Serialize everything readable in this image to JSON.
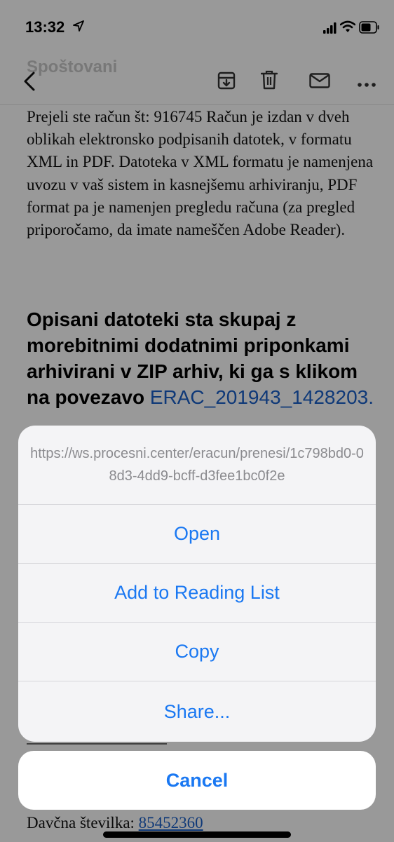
{
  "status_bar": {
    "time": "13:32"
  },
  "nav": {
    "subject": "Spoštovani"
  },
  "email": {
    "paragraph": "Prejeli ste račun št: 916745 Račun je izdan v dveh oblikah elektronsko podpisanih datotek, v formatu XML in PDF. Datoteka v XML formatu je namenjena uvozu v vaš sistem in kasnejšemu arhiviranju, PDF format pa je namenjen pregledu računa (za pregled priporočamo, da imate nameščen Adobe Reader).",
    "heading": "Opisani datoteki sta skupaj z morebitnimi dodatnimi priponkami arhivirani v ZIP arhiv, ki ga s klikom na povezavo",
    "link": "ERAC_201943_1428203.",
    "tax_label": "Davčna številka:",
    "tax_number": "85452360"
  },
  "action_sheet": {
    "url": "https://ws.procesni.center/eracun/prenesi/1c798bd0-08d3-4dd9-bcff-d3fee1bc0f2e",
    "items": [
      {
        "label": "Open"
      },
      {
        "label": "Add to Reading List"
      },
      {
        "label": "Copy"
      },
      {
        "label": "Share..."
      }
    ],
    "cancel": "Cancel"
  },
  "colors": {
    "accent": "#1a78f2",
    "link": "#1a5fc9",
    "overlay": "rgba(0,0,0,0.4)"
  },
  "icons": [
    "location-arrow-icon",
    "signal-icon",
    "wifi-icon",
    "battery-icon",
    "back-icon",
    "archive-icon",
    "trash-icon",
    "mail-icon",
    "more-icon"
  ]
}
